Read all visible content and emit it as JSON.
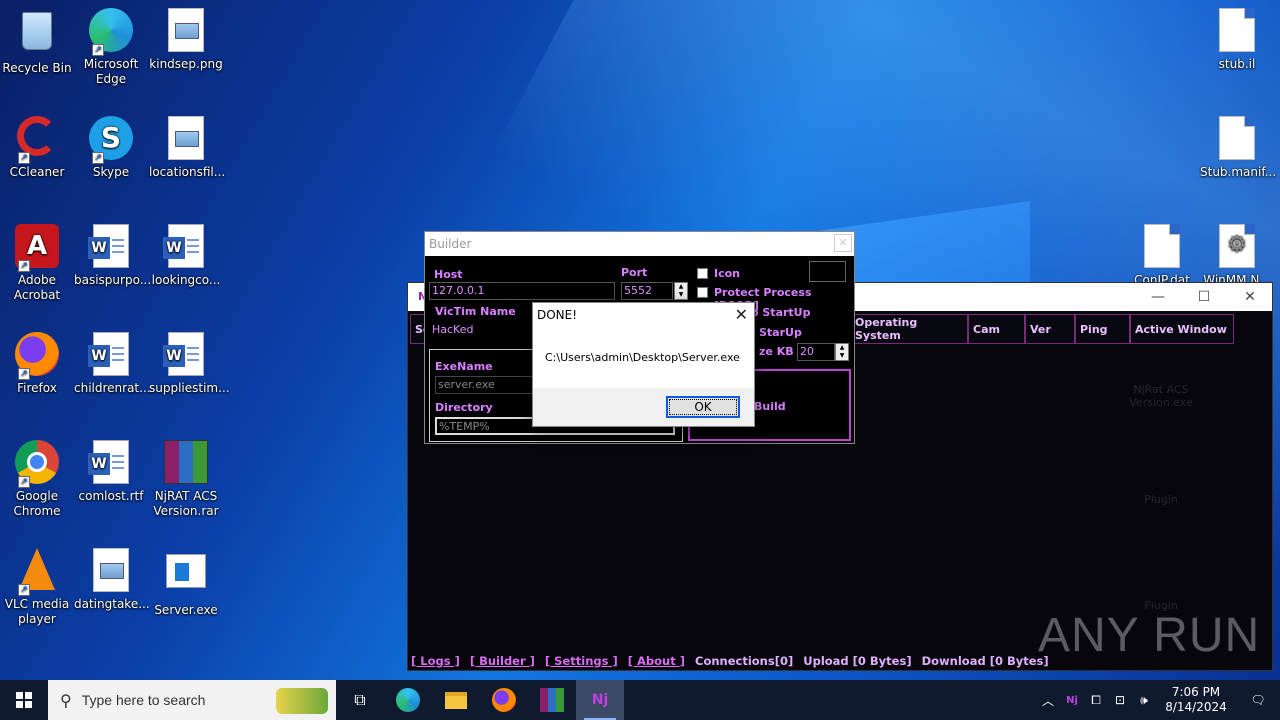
{
  "desktop": {
    "icons": [
      {
        "label": "Recycle Bin"
      },
      {
        "label": "Microsoft Edge"
      },
      {
        "label": "kindsep.png"
      },
      {
        "label": "CCleaner"
      },
      {
        "label": "Skype"
      },
      {
        "label": "locationsfil..."
      },
      {
        "label": "Adobe Acrobat"
      },
      {
        "label": "basispurpo..."
      },
      {
        "label": "lookingco..."
      },
      {
        "label": "Firefox"
      },
      {
        "label": "childrenrat..."
      },
      {
        "label": "suppliestim..."
      },
      {
        "label": "Google Chrome"
      },
      {
        "label": "comlost.rtf"
      },
      {
        "label": "NjRAT ACS Version.rar"
      },
      {
        "label": "VLC media player"
      },
      {
        "label": "datingtake..."
      },
      {
        "label": "Server.exe"
      },
      {
        "label": "stub.il"
      },
      {
        "label": "Stub.manif..."
      },
      {
        "label": "ConIP.dat"
      },
      {
        "label": "WinMM.N..."
      }
    ]
  },
  "rat_window": {
    "title": "N",
    "columns": [
      "Sc",
      "Operating System",
      "Cam",
      "Ver",
      "Ping",
      "Active Window"
    ],
    "status_links": [
      "[ Logs ]",
      "[ Builder ]",
      "[ Settings ]",
      "[ About ]"
    ],
    "status_info": [
      "Connections[0]",
      "Upload [0 Bytes]",
      "Download [0 Bytes]"
    ],
    "ghost_items": [
      "NjRat ACS Version.exe",
      "Plugin",
      "Plugin"
    ]
  },
  "builder": {
    "title": "Builder",
    "host_label": "Host",
    "host_value": "127.0.0.1",
    "port_label": "Port",
    "port_value": "5552",
    "icon_label": "Icon",
    "protect_label": "Protect Process [BSOD]",
    "victim_label": "VicTim Name",
    "victim_value": "HacKed",
    "startup_label": "o StartUp",
    "starup_label": "StarUp",
    "size_label": "ze KB",
    "size_value": "20",
    "exename_label": "ExeName",
    "exename_value": "server.exe",
    "directory_label": "Directory",
    "directory_value": "%TEMP%",
    "build_label": "Build"
  },
  "dialog": {
    "title": "DONE!",
    "message": "C:\\Users\\admin\\Desktop\\Server.exe",
    "ok_label": "OK"
  },
  "taskbar": {
    "search_placeholder": "Type here to search",
    "time": "7:06 PM",
    "date": "8/14/2024"
  },
  "watermark": "ANY RUN"
}
